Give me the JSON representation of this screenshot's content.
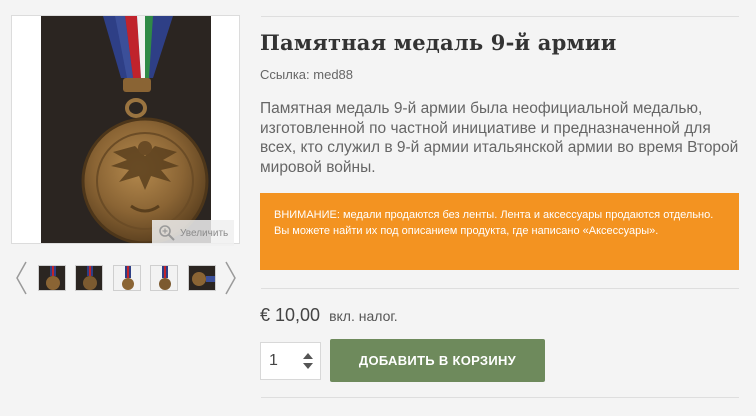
{
  "product": {
    "title": "Памятная медаль 9-й армии",
    "reference_label": "Ссылка:",
    "reference_value": "med88",
    "description": "Памятная медаль 9-й армии была неофициальной медалью, изготовленной по частной инициативе и предназначенной для всех, кто служил в 9-й армии итальянской армии во время Второй мировой войны.",
    "notice": "ВНИМАНИЕ: медали продаются без ленты. Лента и аксессуары продаются отдельно. Вы можете найти их под описанием продукта, где написано «Аксессуары».",
    "price": "€ 10,00",
    "tax_note": "вкл. налог."
  },
  "gallery": {
    "zoom_label": "Увеличить",
    "thumbnail_count": 5
  },
  "cart": {
    "quantity": "1",
    "add_button_label": "ДОБАВИТЬ В КОРЗИНУ"
  },
  "colors": {
    "notice_bg": "#f39321",
    "button_bg": "#6e8a5c",
    "page_bg": "#f4f4f4"
  },
  "icons": {
    "zoom": "magnifier-icon",
    "prev": "chevron-left-icon",
    "next": "chevron-right-icon",
    "quantity": "spinner-arrows-icon"
  }
}
